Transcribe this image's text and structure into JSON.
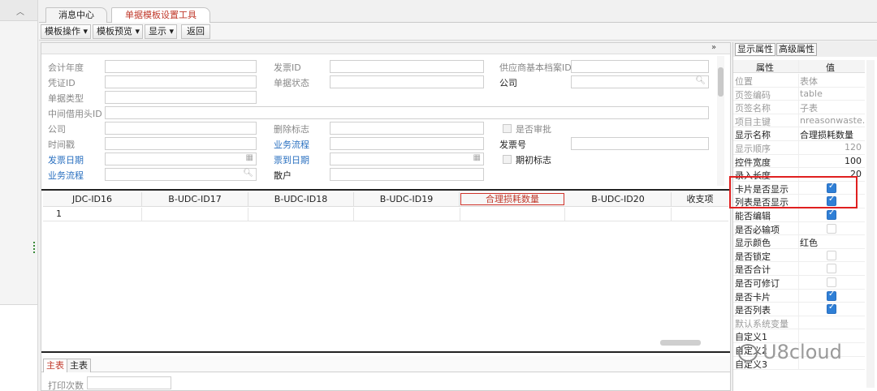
{
  "tabs": [
    {
      "label": "消息中心"
    },
    {
      "label": "单据模板设置工具"
    }
  ],
  "toolbar": {
    "template_ops": "模板操作",
    "template_preview": "模板预览",
    "display": "显示",
    "back": "返回"
  },
  "designer": {
    "collapse_glyph": "»"
  },
  "form": {
    "accounting_year": "会计年度",
    "invoice_id": "发票ID",
    "supplier_id": "供应商基本档案ID",
    "voucher_id": "凭证ID",
    "doc_status": "单据状态",
    "company1": "公司",
    "doc_type": "单据类型",
    "borrow_head_id": "中间借用头ID",
    "company2": "公司",
    "delete_flag": "删除标志",
    "need_approve": "是否审批",
    "timestamp": "时间戳",
    "business_flow1": "业务流程",
    "invoice_no": "发票号",
    "invoice_date": "发票日期",
    "arrive_date": "票到日期",
    "opening_flag": "期初标志",
    "business_flow2": "业务流程",
    "retail": "散户"
  },
  "grid": {
    "columns": [
      "JDC-ID16",
      "B-UDC-ID17",
      "B-UDC-ID18",
      "B-UDC-ID19",
      "合理损耗数量",
      "B-UDC-ID20",
      "收支项"
    ],
    "row_number": "1"
  },
  "bottom_tabs": {
    "main": "主表",
    "sub": "主表"
  },
  "print_count_label": "打印次数",
  "right_panel": {
    "tab_display": "显示属性",
    "tab_advanced": "高级属性",
    "col_property": "属性",
    "col_value": "值",
    "rows": [
      {
        "name": "位置",
        "value": "表体",
        "gray": true
      },
      {
        "name": "页签编码",
        "value": "table",
        "gray": true
      },
      {
        "name": "页签名称",
        "value": "子表",
        "gray": true
      },
      {
        "name": "项目主键",
        "value": "nreasonwaste...",
        "gray": true
      },
      {
        "name": "显示名称",
        "value": "合理损耗数量",
        "gray": false
      },
      {
        "name": "显示顺序",
        "value": "120",
        "gray": true,
        "right": true
      },
      {
        "name": "控件宽度",
        "value": "100",
        "gray": false,
        "right": true
      },
      {
        "name": "录入长度",
        "value": "20",
        "gray": false,
        "right": true
      },
      {
        "name": "卡片是否显示",
        "check": true
      },
      {
        "name": "列表是否显示",
        "check": true
      },
      {
        "name": "能否编辑",
        "check": true
      },
      {
        "name": "是否必输项",
        "check": false
      },
      {
        "name": "显示颜色",
        "value": "红色",
        "gray": false
      },
      {
        "name": "是否锁定",
        "check": false
      },
      {
        "name": "是否合计",
        "check": false
      },
      {
        "name": "是否可修订",
        "check": false
      },
      {
        "name": "是否卡片",
        "check": true
      },
      {
        "name": "是否列表",
        "check": true
      },
      {
        "name": "默认系统变量",
        "value": "",
        "gray": true
      },
      {
        "name": "自定义1",
        "value": "",
        "gray": false
      },
      {
        "name": "自定义2",
        "value": "",
        "gray": false
      },
      {
        "name": "自定义3",
        "value": "",
        "gray": false
      }
    ]
  },
  "watermark": "U8cloud",
  "colors": {
    "highlight_red": "#e02020",
    "check_blue": "#2f7fd6",
    "link_blue": "#2a70c0"
  }
}
